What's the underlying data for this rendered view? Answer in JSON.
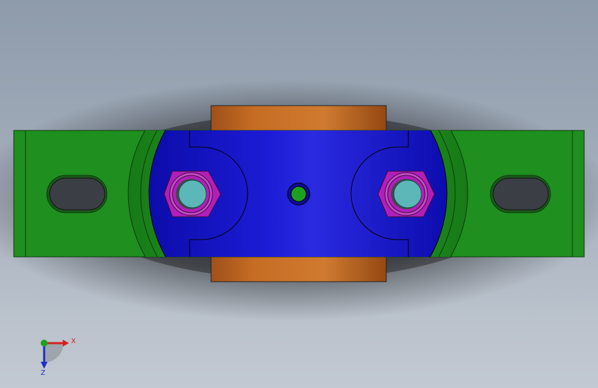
{
  "window": {
    "title": "",
    "background_top": "#8e9bab",
    "background_bottom": "#c2c9d2"
  },
  "model": {
    "parts": [
      {
        "name": "base-plate",
        "color": "#1f8f1f"
      },
      {
        "name": "clamp-block",
        "color": "#1515c8"
      },
      {
        "name": "shaft-sleeve",
        "color": "#c0681e"
      },
      {
        "name": "hex-nut",
        "color": "#b21fb8"
      },
      {
        "name": "bolt-end",
        "color": "#5cb7b8"
      },
      {
        "name": "center-pin",
        "color": "#1f9f1f"
      }
    ],
    "slots": [
      "left-mounting-slot",
      "right-mounting-slot"
    ]
  },
  "triad": {
    "x_label": "X",
    "z_label": "Z",
    "x_color": "#d42020",
    "y_color": "#1fa01f",
    "z_color": "#1f2fc0"
  }
}
